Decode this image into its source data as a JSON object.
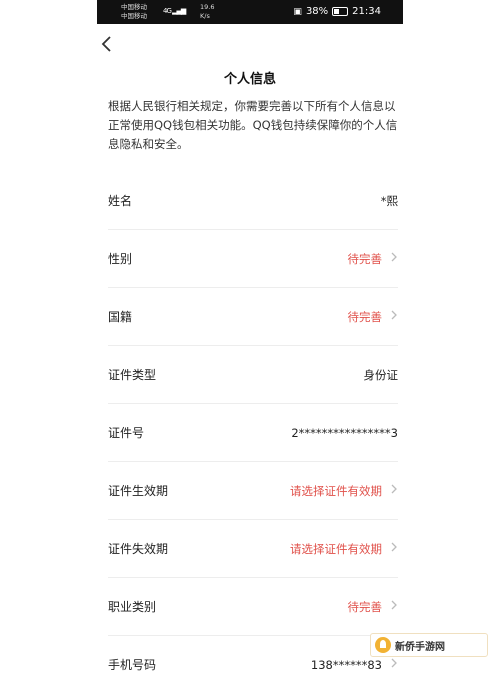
{
  "status_bar": {
    "carrier_1": "中国移动",
    "carrier_2": "中国移动",
    "signal_1": "4G ▂▄▆",
    "speed": "19.6\nK/s",
    "battery": "38%",
    "time": "21:34"
  },
  "header": {
    "title": "个人信息"
  },
  "notice": "根据人民银行相关规定，你需要完善以下所有个人信息以正常使用QQ钱包相关功能。QQ钱包持续保障你的个人信息隐私和安全。",
  "rows": [
    {
      "label": "姓名",
      "value": "*熙",
      "state": "filled",
      "chevron": false
    },
    {
      "label": "性别",
      "value": "待完善",
      "state": "pending",
      "chevron": true
    },
    {
      "label": "国籍",
      "value": "待完善",
      "state": "pending",
      "chevron": true
    },
    {
      "label": "证件类型",
      "value": "身份证",
      "state": "filled",
      "chevron": false
    },
    {
      "label": "证件号",
      "value": "2****************3",
      "state": "filled",
      "chevron": false
    },
    {
      "label": "证件生效期",
      "value": "请选择证件有效期",
      "state": "pending",
      "chevron": true
    },
    {
      "label": "证件失效期",
      "value": "请选择证件有效期",
      "state": "pending",
      "chevron": true
    },
    {
      "label": "职业类别",
      "value": "待完善",
      "state": "pending",
      "chevron": true
    },
    {
      "label": "手机号码",
      "value": "138******83",
      "state": "filled",
      "chevron": true
    }
  ],
  "watermark": "新侨手游网",
  "colors": {
    "pending": "#e0504a",
    "status_bar": "#111111"
  },
  "icons": {
    "back": "chevron-left-icon",
    "row_arrow": "chevron-right-icon"
  }
}
